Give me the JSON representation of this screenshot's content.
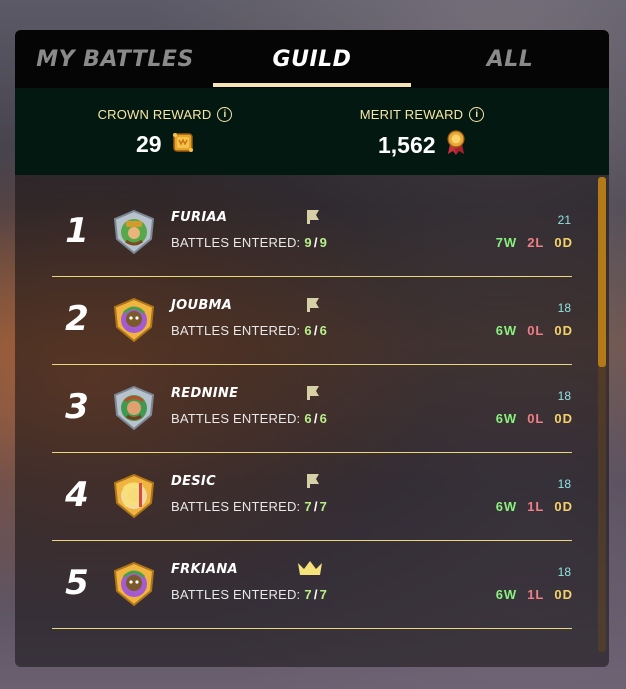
{
  "tabs": [
    {
      "label": "MY BATTLES",
      "active": false
    },
    {
      "label": "GUILD",
      "active": true
    },
    {
      "label": "ALL",
      "active": false
    }
  ],
  "rewards": {
    "crown": {
      "label": "CROWN REWARD",
      "value": "29",
      "icon": "crown-chest-icon"
    },
    "merit": {
      "label": "MERIT REWARD",
      "value": "1,562",
      "icon": "merit-medal-icon"
    }
  },
  "colors": {
    "active_tab_underline": "#f3e6b4",
    "reward_bar_bg": "#041812",
    "wins": "#8af07e",
    "losses": "#f07e86",
    "draws": "#f6d36a",
    "points": "#8fe3e0",
    "divider": "#e9d77a",
    "scrollbar": "#b47a17"
  },
  "scroll": {
    "thumb_fraction": 0.4
  },
  "battles_label": "BATTLES ENTERED:",
  "players": [
    {
      "rank": "1",
      "name": "FURIAA",
      "entered": "9",
      "total": "9",
      "points": "21",
      "wins": "7W",
      "losses": "2L",
      "draws": "0D",
      "badge": "bookmark-flag-icon",
      "avatar": "silver-shield-avatar"
    },
    {
      "rank": "2",
      "name": "JOUBMA",
      "entered": "6",
      "total": "6",
      "points": "18",
      "wins": "6W",
      "losses": "0L",
      "draws": "0D",
      "badge": "bookmark-flag-icon",
      "avatar": "gold-shield-avatar"
    },
    {
      "rank": "3",
      "name": "REDNINE",
      "entered": "6",
      "total": "6",
      "points": "18",
      "wins": "6W",
      "losses": "0L",
      "draws": "0D",
      "badge": "bookmark-flag-icon",
      "avatar": "silver-shield-avatar"
    },
    {
      "rank": "4",
      "name": "DESIC",
      "entered": "7",
      "total": "7",
      "points": "18",
      "wins": "6W",
      "losses": "1L",
      "draws": "0D",
      "badge": "bookmark-flag-icon",
      "avatar": "gold-shield-avatar"
    },
    {
      "rank": "5",
      "name": "FRKIANA",
      "entered": "7",
      "total": "7",
      "points": "18",
      "wins": "6W",
      "losses": "1L",
      "draws": "0D",
      "badge": "crown-icon",
      "avatar": "gold-shield-avatar"
    }
  ]
}
